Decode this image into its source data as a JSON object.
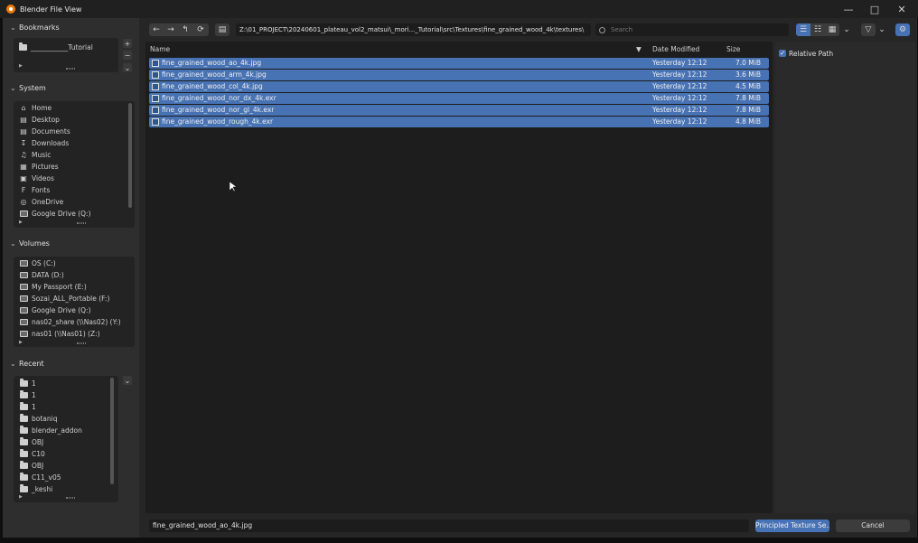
{
  "window": {
    "title": "Blender File View"
  },
  "bookmarks": {
    "header": "Bookmarks",
    "items": [
      "___________Tutorial"
    ]
  },
  "system": {
    "header": "System",
    "items": [
      {
        "label": "Home",
        "icon": "home-icon"
      },
      {
        "label": "Desktop",
        "icon": "desktop-icon"
      },
      {
        "label": "Documents",
        "icon": "documents-icon"
      },
      {
        "label": "Downloads",
        "icon": "download-icon"
      },
      {
        "label": "Music",
        "icon": "music-icon"
      },
      {
        "label": "Pictures",
        "icon": "pictures-icon"
      },
      {
        "label": "Videos",
        "icon": "videos-icon"
      },
      {
        "label": "Fonts",
        "icon": "font-icon"
      },
      {
        "label": "OneDrive",
        "icon": "globe-icon"
      },
      {
        "label": "Google Drive (Q:)",
        "icon": "drive-icon"
      }
    ]
  },
  "volumes": {
    "header": "Volumes",
    "items": [
      "OS (C:)",
      "DATA (D:)",
      "My Passport (E:)",
      "Sozai_ALL_Portable (F:)",
      "Google Drive (Q:)",
      "nas02_share (\\\\Nas02) (Y:)",
      "nas01 (\\\\Nas01) (Z:)"
    ]
  },
  "recent": {
    "header": "Recent",
    "items": [
      "1",
      "1",
      "1",
      "botaniq",
      "blender_addon",
      "OBJ",
      "C10",
      "OBJ",
      "C11_v05",
      "_keshi"
    ]
  },
  "toolbar": {
    "path": "Z:\\01_PROJECT\\20240601_plateau_vol2_matsui\\_mori..._Tutorial\\src\\Textures\\fine_grained_wood_4k\\textures\\",
    "search_placeholder": "Search"
  },
  "columns": {
    "name": "Name",
    "date": "Date Modified",
    "size": "Size"
  },
  "files": [
    {
      "name": "fine_grained_wood_ao_4k.jpg",
      "date": "Yesterday 12:12",
      "size": "7.0 MiB"
    },
    {
      "name": "fine_grained_wood_arm_4k.jpg",
      "date": "Yesterday 12:12",
      "size": "3.6 MiB"
    },
    {
      "name": "fine_grained_wood_col_4k.jpg",
      "date": "Yesterday 12:12",
      "size": "4.5 MiB"
    },
    {
      "name": "fine_grained_wood_nor_dx_4k.exr",
      "date": "Yesterday 12:12",
      "size": "7.8 MiB"
    },
    {
      "name": "fine_grained_wood_nor_gl_4k.exr",
      "date": "Yesterday 12:12",
      "size": "7.8 MiB"
    },
    {
      "name": "fine_grained_wood_rough_4k.exr",
      "date": "Yesterday 12:12",
      "size": "4.8 MiB"
    }
  ],
  "options": {
    "relative_path_label": "Relative Path",
    "relative_path_checked": true
  },
  "footer": {
    "filename": "fine_grained_wood_ao_4k.jpg",
    "confirm_label": "Principled Texture Se...",
    "cancel_label": "Cancel"
  },
  "colors": {
    "accent": "#4772b3",
    "background": "#1d1d1d",
    "panel": "#2e2e2e"
  }
}
